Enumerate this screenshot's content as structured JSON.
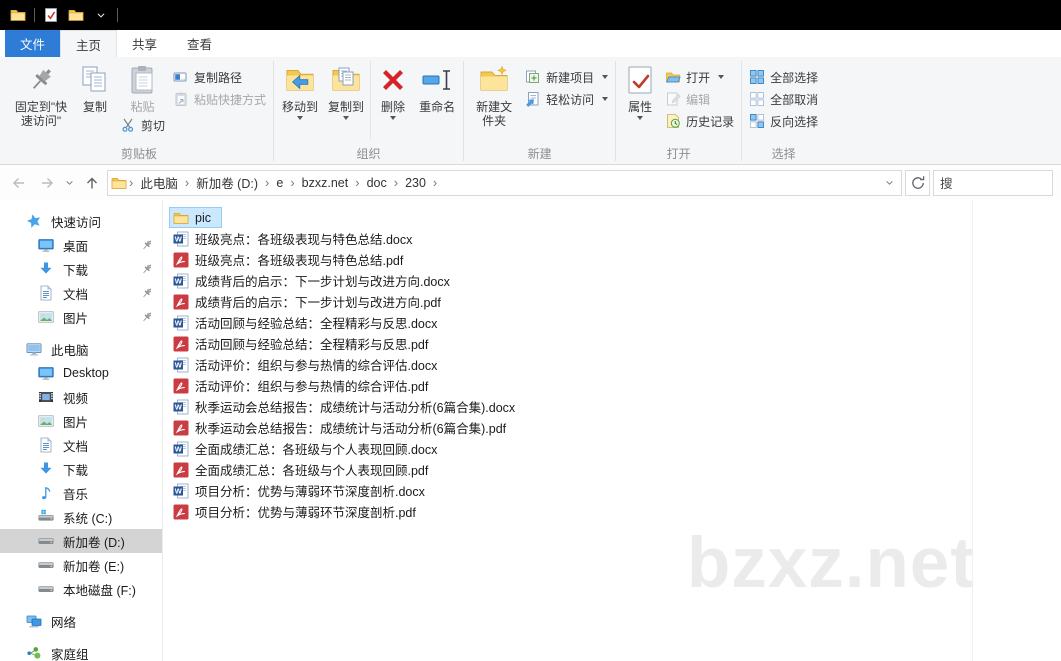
{
  "tabs": {
    "file": "文件",
    "home": "主页",
    "share": "共享",
    "view": "查看"
  },
  "ribbon": {
    "pin_to_quick_access": "固定到\"快速访问\"",
    "copy": "复制",
    "paste": "粘贴",
    "cut": "剪切",
    "copy_path": "复制路径",
    "paste_shortcut": "粘贴快捷方式",
    "clipboard_group": "剪贴板",
    "move_to": "移动到",
    "copy_to": "复制到",
    "delete": "删除",
    "rename": "重命名",
    "organize_group": "组织",
    "new_folder": "新建文件夹",
    "new_item": "新建项目",
    "easy_access": "轻松访问",
    "new_group": "新建",
    "properties": "属性",
    "open": "打开",
    "edit": "编辑",
    "history": "历史记录",
    "open_group": "打开",
    "select_all": "全部选择",
    "select_none": "全部取消",
    "invert_selection": "反向选择",
    "select_group": "选择"
  },
  "address_bar": {
    "breadcrumb": [
      "此电脑",
      "新加卷 (D:)",
      "e",
      "bzxz.net",
      "doc",
      "230"
    ],
    "search_text": "搜"
  },
  "sidebar": {
    "items": [
      {
        "label": "快速访问",
        "icon": "quick-access-star-icon",
        "level": 0,
        "pinned": false,
        "selected": false,
        "gap_before": false
      },
      {
        "label": "桌面",
        "icon": "desktop-icon",
        "level": 1,
        "pinned": true,
        "selected": false,
        "gap_before": false
      },
      {
        "label": "下载",
        "icon": "download-icon",
        "level": 1,
        "pinned": true,
        "selected": false,
        "gap_before": false
      },
      {
        "label": "文档",
        "icon": "document-icon",
        "level": 1,
        "pinned": true,
        "selected": false,
        "gap_before": false
      },
      {
        "label": "图片",
        "icon": "pictures-icon",
        "level": 1,
        "pinned": true,
        "selected": false,
        "gap_before": false
      },
      {
        "label": "此电脑",
        "icon": "computer-icon",
        "level": 0,
        "pinned": false,
        "selected": false,
        "gap_before": true
      },
      {
        "label": "Desktop",
        "icon": "desktop-icon",
        "level": 1,
        "pinned": false,
        "selected": false,
        "gap_before": false
      },
      {
        "label": "视频",
        "icon": "videos-icon",
        "level": 1,
        "pinned": false,
        "selected": false,
        "gap_before": false
      },
      {
        "label": "图片",
        "icon": "pictures-icon",
        "level": 1,
        "pinned": false,
        "selected": false,
        "gap_before": false
      },
      {
        "label": "文档",
        "icon": "document-icon",
        "level": 1,
        "pinned": false,
        "selected": false,
        "gap_before": false
      },
      {
        "label": "下载",
        "icon": "download-icon",
        "level": 1,
        "pinned": false,
        "selected": false,
        "gap_before": false
      },
      {
        "label": "音乐",
        "icon": "music-icon",
        "level": 1,
        "pinned": false,
        "selected": false,
        "gap_before": false
      },
      {
        "label": "系统 (C:)",
        "icon": "system-drive-icon",
        "level": 1,
        "pinned": false,
        "selected": false,
        "gap_before": false
      },
      {
        "label": "新加卷 (D:)",
        "icon": "drive-icon",
        "level": 1,
        "pinned": false,
        "selected": true,
        "gap_before": false
      },
      {
        "label": "新加卷 (E:)",
        "icon": "drive-icon",
        "level": 1,
        "pinned": false,
        "selected": false,
        "gap_before": false
      },
      {
        "label": "本地磁盘 (F:)",
        "icon": "drive-icon",
        "level": 1,
        "pinned": false,
        "selected": false,
        "gap_before": false
      },
      {
        "label": "网络",
        "icon": "network-icon",
        "level": 0,
        "pinned": false,
        "selected": false,
        "gap_before": true
      },
      {
        "label": "家庭组",
        "icon": "homegroup-icon",
        "level": 0,
        "pinned": false,
        "selected": false,
        "gap_before": true
      }
    ]
  },
  "files": [
    {
      "name": "pic",
      "icon": "folder-icon",
      "selected": true
    },
    {
      "name": "班级亮点：各班级表现与特色总结.docx",
      "icon": "word-icon",
      "selected": false
    },
    {
      "name": "班级亮点：各班级表现与特色总结.pdf",
      "icon": "pdf-icon",
      "selected": false
    },
    {
      "name": "成绩背后的启示：下一步计划与改进方向.docx",
      "icon": "word-icon",
      "selected": false
    },
    {
      "name": "成绩背后的启示：下一步计划与改进方向.pdf",
      "icon": "pdf-icon",
      "selected": false
    },
    {
      "name": "活动回顾与经验总结：全程精彩与反思.docx",
      "icon": "word-icon",
      "selected": false
    },
    {
      "name": "活动回顾与经验总结：全程精彩与反思.pdf",
      "icon": "pdf-icon",
      "selected": false
    },
    {
      "name": "活动评价：组织与参与热情的综合评估.docx",
      "icon": "word-icon",
      "selected": false
    },
    {
      "name": "活动评价：组织与参与热情的综合评估.pdf",
      "icon": "pdf-icon",
      "selected": false
    },
    {
      "name": "秋季运动会总结报告：成绩统计与活动分析(6篇合集).docx",
      "icon": "word-icon",
      "selected": false
    },
    {
      "name": "秋季运动会总结报告：成绩统计与活动分析(6篇合集).pdf",
      "icon": "pdf-icon",
      "selected": false
    },
    {
      "name": "全面成绩汇总：各班级与个人表现回顾.docx",
      "icon": "word-icon",
      "selected": false
    },
    {
      "name": "全面成绩汇总：各班级与个人表现回顾.pdf",
      "icon": "pdf-icon",
      "selected": false
    },
    {
      "name": "项目分析：优势与薄弱环节深度剖析.docx",
      "icon": "word-icon",
      "selected": false
    },
    {
      "name": "项目分析：优势与薄弱环节深度剖析.pdf",
      "icon": "pdf-icon",
      "selected": false
    }
  ],
  "watermark": "bzxz.net",
  "colors": {
    "titlebar": "#000000",
    "file_tab_blue": "#2f7cd6",
    "file_selection": "#cce8ff",
    "file_selection_border": "#95cdf5",
    "sidebar_selected": "#d4d4d4",
    "watermark": "#ebebeb"
  }
}
